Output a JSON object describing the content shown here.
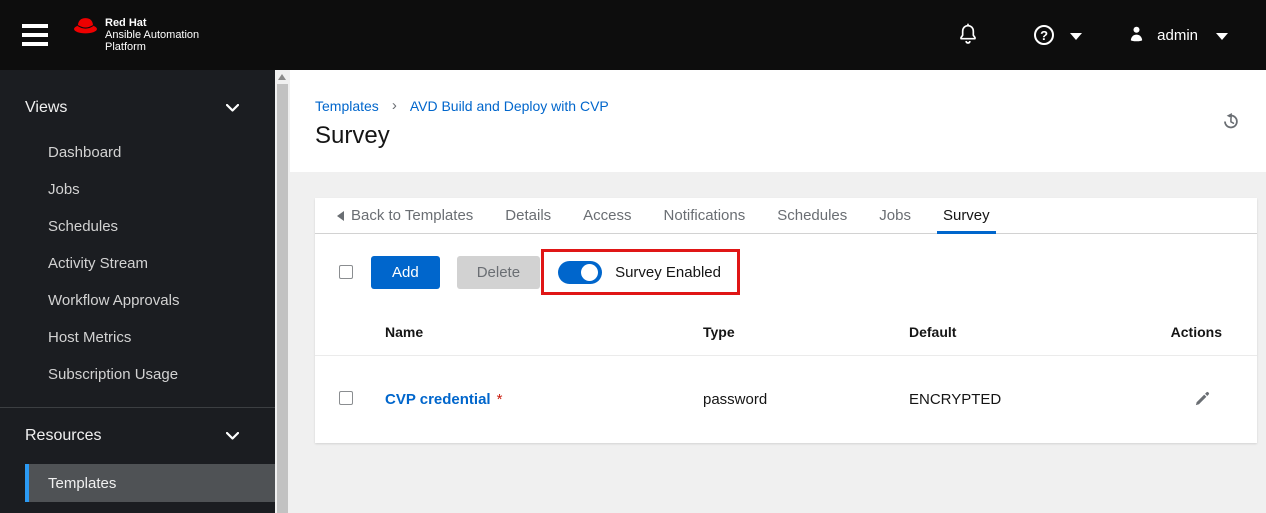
{
  "masthead": {
    "brand": {
      "line1": "Red Hat",
      "line2": "Ansible Automation",
      "line3": "Platform"
    },
    "user_label": "admin"
  },
  "sidebar": {
    "groups": [
      {
        "label": "Views",
        "items": [
          {
            "label": "Dashboard"
          },
          {
            "label": "Jobs"
          },
          {
            "label": "Schedules"
          },
          {
            "label": "Activity Stream"
          },
          {
            "label": "Workflow Approvals"
          },
          {
            "label": "Host Metrics"
          },
          {
            "label": "Subscription Usage"
          }
        ]
      },
      {
        "label": "Resources",
        "items": [
          {
            "label": "Templates",
            "active": true
          }
        ]
      }
    ]
  },
  "breadcrumb": {
    "items": [
      "Templates",
      "AVD Build and Deploy with CVP"
    ],
    "separator": "›"
  },
  "page": {
    "title": "Survey"
  },
  "tabs": [
    {
      "label": "Back to Templates"
    },
    {
      "label": "Details"
    },
    {
      "label": "Access"
    },
    {
      "label": "Notifications"
    },
    {
      "label": "Schedules"
    },
    {
      "label": "Jobs"
    },
    {
      "label": "Survey",
      "active": true
    }
  ],
  "toolbar": {
    "add_label": "Add",
    "delete_label": "Delete",
    "toggle_label": "Survey Enabled",
    "toggle_state": "on"
  },
  "table": {
    "headers": [
      "Name",
      "Type",
      "Default",
      "Actions"
    ],
    "rows": [
      {
        "name": "CVP credential",
        "required_mark": "*",
        "type": "password",
        "default": "ENCRYPTED"
      }
    ]
  },
  "icons": [
    "hamburger-icon",
    "redhat-logo-icon",
    "bell-icon",
    "help-icon",
    "caret-down-icon",
    "user-icon",
    "chevron-down-icon",
    "history-icon",
    "back-caret-icon",
    "pencil-icon",
    "scroll-up-arrow-icon"
  ],
  "colors": {
    "accent_blue": "#0066cc",
    "annotation_red": "#e01616",
    "required_red": "#c9190b",
    "nav_active_indicator": "#2b9af3",
    "masthead_bg": "#0d0d0d",
    "sidebar_bg": "#1b1d21",
    "content_bg": "#f0f0f0"
  }
}
